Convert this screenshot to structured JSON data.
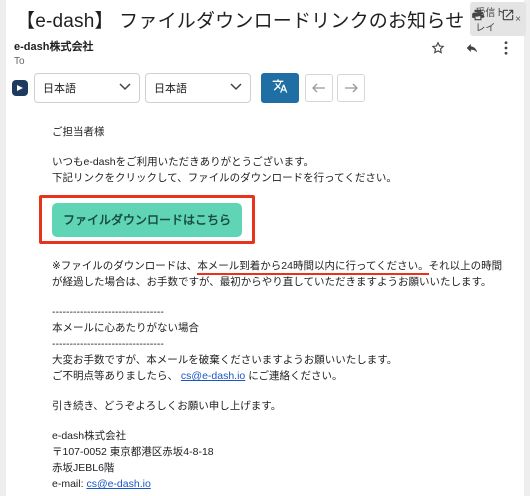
{
  "subject": "【e-dash】 ファイルダウンロードリンクのお知らせ",
  "folder_chip": "受信トレイ",
  "folder_chip_close": "×",
  "sender": {
    "name": "e-dash株式会社",
    "to_label": "To"
  },
  "translate": {
    "source_lang": "日本語",
    "target_lang": "日本語",
    "chevron": "⌄"
  },
  "body": {
    "greeting": "ご担当者様",
    "line1": "いつもe-dashをご利用いただきありがとうございます。",
    "line2": "下記リンクをクリックして、ファイルのダウンロードを行ってください。",
    "cta_label": "ファイルダウンロードはこちら",
    "note_prefix": "※ファイルのダウンロードは、",
    "note_highlight": "本メール到着から24時間以内に行ってください。",
    "note_suffix": "それ以上の時間",
    "note_line2": "が経過した場合は、お手数ですが、最初からやり直していただきますようお願いいたします。",
    "divider": "--------------------------------",
    "notice_heading": "本メールに心あたりがない場合",
    "apology_line": "大変お手数ですが、本メールを破棄くださいますようお願いいたします。",
    "contact_prefix": "ご不明点等ありましたら、",
    "contact_email": "cs@e-dash.io",
    "contact_suffix": "にご連絡ください。",
    "closing": "引き続き、どうぞよろしくお願い申し上げます。",
    "sig_company": "e-dash株式会社",
    "sig_address1": "〒107-0052 東京都港区赤坂4-8-18",
    "sig_address2": "赤坂JEBL6階",
    "sig_email_label": "e-mail: ",
    "sig_email": "cs@e-dash.io"
  },
  "icons": [
    "print-icon",
    "open-external-icon",
    "star-icon",
    "reply-icon",
    "more-vert-icon",
    "e-dash-logo-icon",
    "translate-icon",
    "arrow-left-icon",
    "arrow-right-icon",
    "chevron-down-icon"
  ],
  "colors": {
    "cta_bg": "#5fd5b6",
    "highlight_red": "#e8321c",
    "translate_btn": "#1f6fa5",
    "link": "#1a56c4"
  }
}
